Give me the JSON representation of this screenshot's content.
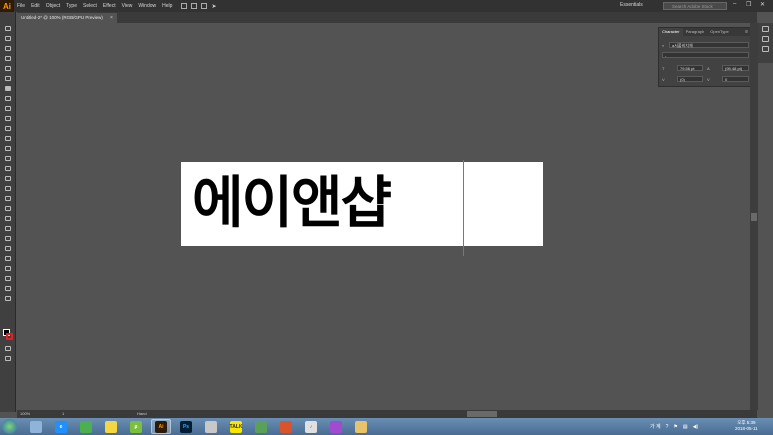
{
  "app": {
    "logo": "Ai"
  },
  "menu": [
    "File",
    "Edit",
    "Object",
    "Type",
    "Select",
    "Effect",
    "View",
    "Window",
    "Help"
  ],
  "workspace": "Essentials",
  "stock_search_placeholder": "Search Adobe Stock",
  "document_tab": {
    "title": "Untitled-2* @ 100% (RGB/GPU Preview)",
    "close": "×"
  },
  "artboard_text": "에이앤샵",
  "character_panel": {
    "tabs": [
      "Character",
      "Paragraph",
      "OpenType"
    ],
    "font_family": "a서풀비치체",
    "font_style": "-",
    "font_size": "79.56 pt",
    "leading": "(95.48 pt)",
    "kerning": "(0)",
    "tracking": "0"
  },
  "status": {
    "zoom": "100%",
    "artboard_num": "1",
    "tool": "Hand"
  },
  "taskbar": {
    "apps": [
      {
        "name": "windows-explorer",
        "label": ""
      },
      {
        "name": "internet-explorer",
        "label": "e"
      },
      {
        "name": "chrome",
        "label": ""
      },
      {
        "name": "sticky-notes",
        "label": ""
      },
      {
        "name": "utorrent",
        "label": "µ"
      },
      {
        "name": "illustrator",
        "label": "Ai"
      },
      {
        "name": "photoshop",
        "label": "Ps"
      },
      {
        "name": "notepad",
        "label": ""
      },
      {
        "name": "kakaotalk",
        "label": "TALK"
      },
      {
        "name": "map",
        "label": ""
      },
      {
        "name": "crop-tool",
        "label": ""
      },
      {
        "name": "itunes",
        "label": "♪"
      },
      {
        "name": "media",
        "label": ""
      },
      {
        "name": "folder",
        "label": ""
      }
    ],
    "ime": "가 계",
    "clock_time": "오후 5:39",
    "clock_date": "2018-05-11"
  },
  "colors": {
    "accent_ai": "#ff9a00",
    "workspace_bg": "#535353",
    "ui_dark": "#323232",
    "taskbar": "#4a6c92"
  }
}
